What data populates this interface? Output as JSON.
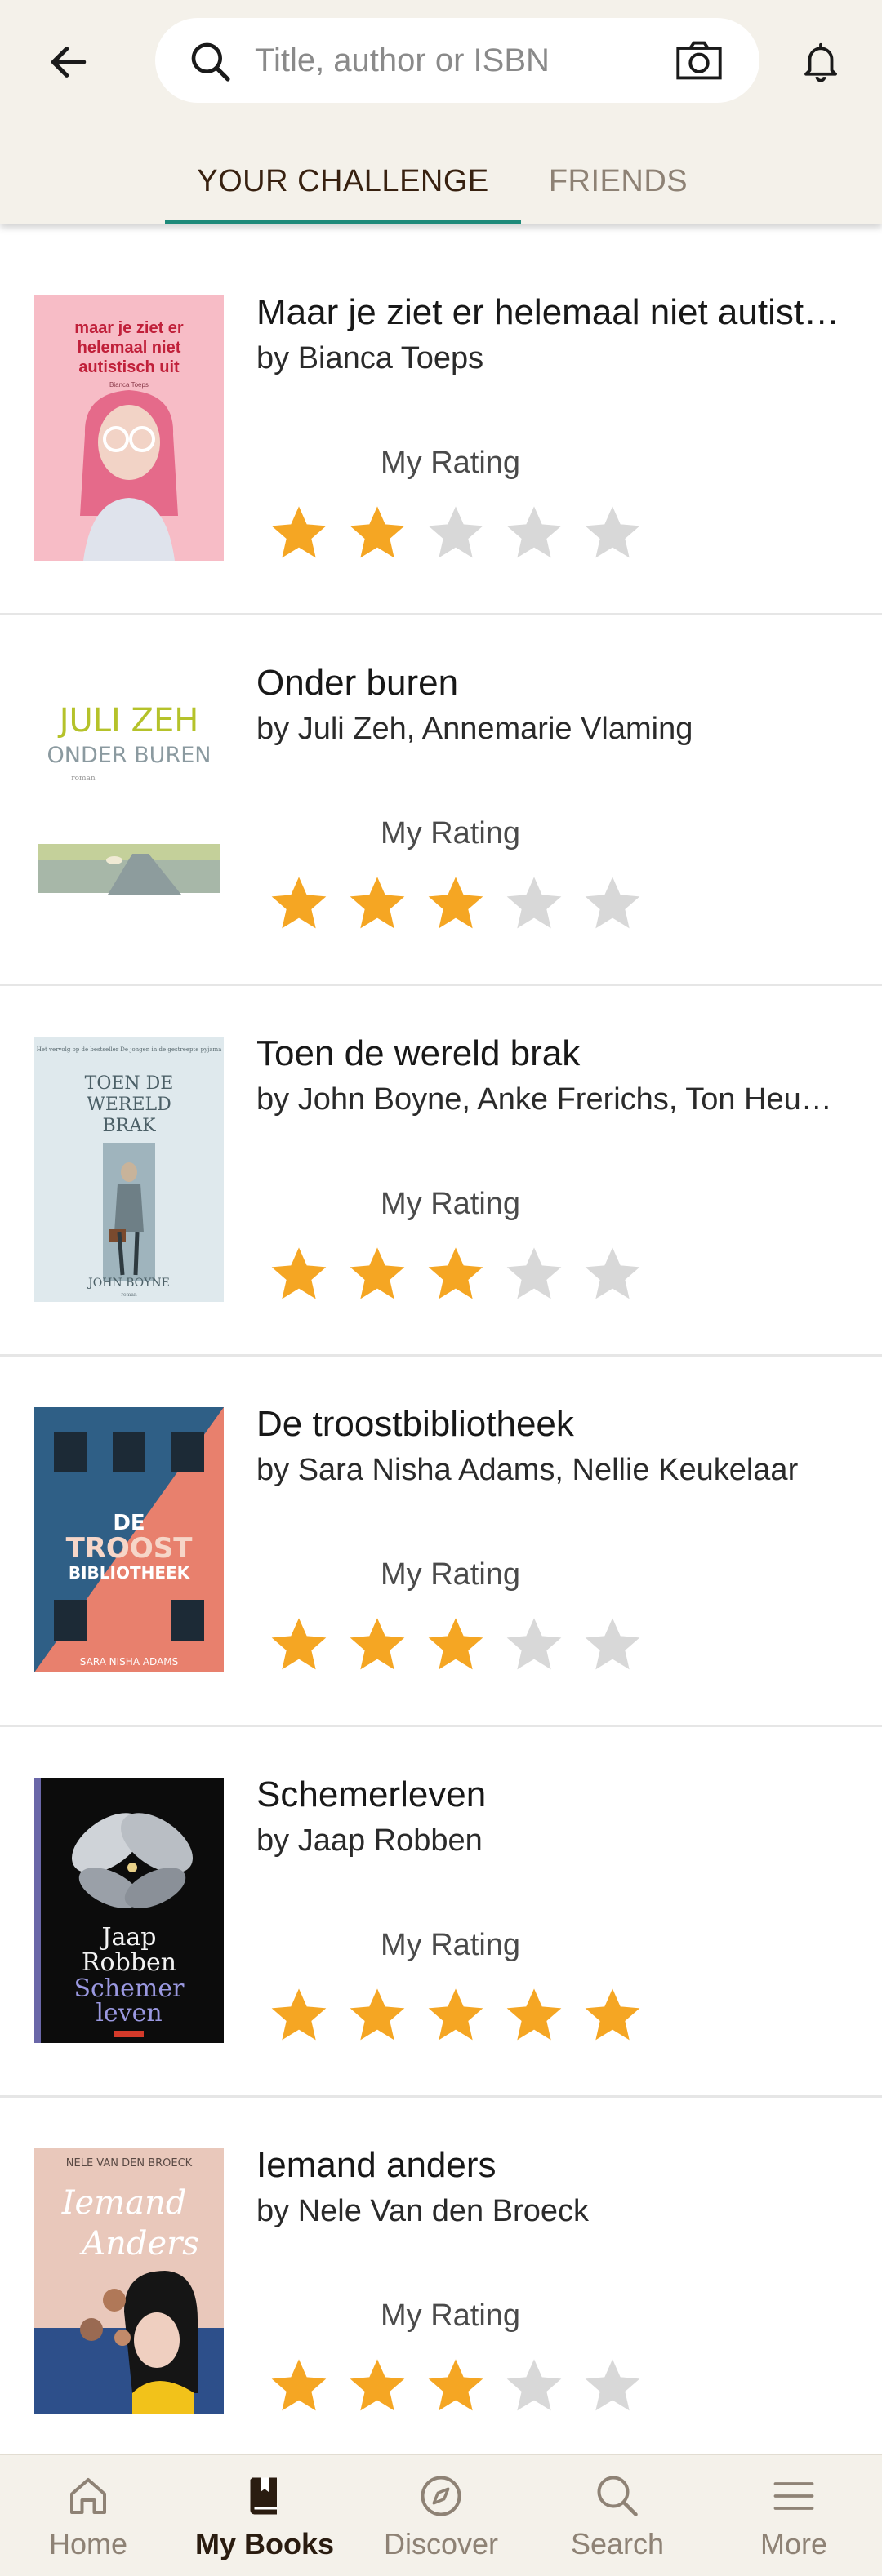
{
  "header": {
    "search_placeholder": "Title, author or ISBN",
    "icons": {
      "back": "arrow-left-icon",
      "search": "search-icon",
      "camera": "camera-icon",
      "notifications": "bell-icon"
    }
  },
  "tabs": [
    {
      "label": "YOUR CHALLENGE",
      "active": true
    },
    {
      "label": "FRIENDS",
      "active": false
    }
  ],
  "colors": {
    "header_bg": "#f4f1ea",
    "tab_accent": "#1e8a7a",
    "star_filled": "#f5a623",
    "star_empty": "#d8d8d8"
  },
  "books": [
    {
      "title": "Maar je ziet er helemaal niet autistisch uit",
      "author_line": "by Bianca Toeps",
      "rating_label": "My Rating",
      "rating": 2,
      "max_rating": 5,
      "cover": {
        "lines": [
          "maar je ziet er",
          "helemaal niet",
          "autistisch uit"
        ],
        "small": "Bianca Toeps"
      }
    },
    {
      "title": "Onder buren",
      "author_line": "by Juli Zeh, Annemarie Vlaming",
      "rating_label": "My Rating",
      "rating": 3,
      "max_rating": 5,
      "cover": {
        "lines": [
          "JULI ZEH",
          "ONDER BUREN"
        ],
        "small": "roman"
      }
    },
    {
      "title": "Toen de wereld brak",
      "author_line": "by John Boyne, Anke Frerichs, Ton Heuvelmans",
      "rating_label": "My Rating",
      "rating": 3,
      "max_rating": 5,
      "cover": {
        "lines": [
          "TOEN DE",
          "WERELD",
          "BRAK"
        ],
        "tagline": "Het vervolg op de bestseller De jongen in de gestreepte pyjama",
        "author": "JOHN BOYNE",
        "small": "roman"
      }
    },
    {
      "title": "De troostbibliotheek",
      "author_line": "by Sara Nisha Adams, Nellie Keukelaar",
      "rating_label": "My Rating",
      "rating": 3,
      "max_rating": 5,
      "cover": {
        "lines": [
          "DE",
          "TROOST",
          "BIBLIOTHEEK"
        ],
        "author": "SARA NISHA ADAMS"
      }
    },
    {
      "title": "Schemerleven",
      "author_line": "by Jaap Robben",
      "rating_label": "My Rating",
      "rating": 5,
      "max_rating": 5,
      "cover": {
        "lines": [
          "Jaap",
          "Robben",
          "Schemer",
          "leven"
        ]
      }
    },
    {
      "title": "Iemand anders",
      "author_line": "by Nele Van den Broeck",
      "rating_label": "My Rating",
      "rating": 3,
      "max_rating": 5,
      "cover": {
        "lines": [
          "NELE VAN DEN BROECK",
          "Iemand",
          "Anders"
        ]
      }
    }
  ],
  "bottom_nav": [
    {
      "label": "Home",
      "icon": "home-icon",
      "active": false
    },
    {
      "label": "My Books",
      "icon": "book-icon",
      "active": true
    },
    {
      "label": "Discover",
      "icon": "compass-icon",
      "active": false
    },
    {
      "label": "Search",
      "icon": "search-icon",
      "active": false
    },
    {
      "label": "More",
      "icon": "menu-icon",
      "active": false
    }
  ]
}
